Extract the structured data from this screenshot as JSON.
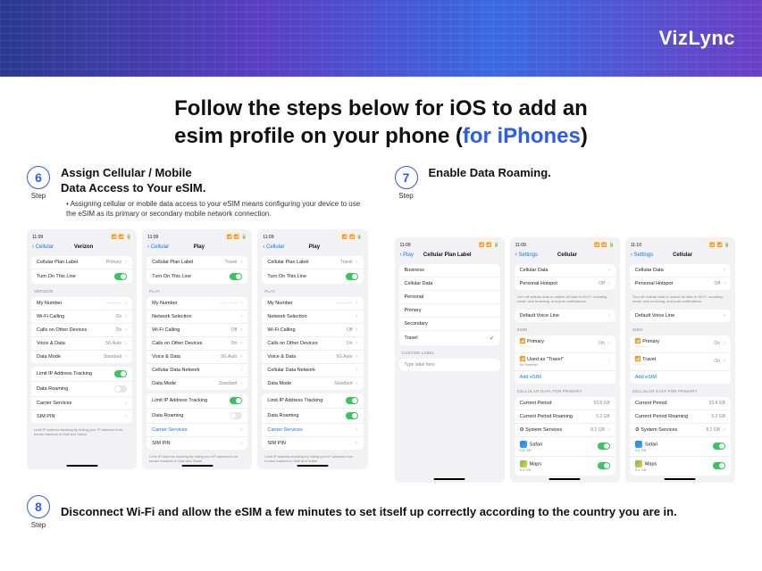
{
  "brand": "VizLync",
  "title_line1": "Follow the steps below for iOS to add an",
  "title_line2_a": "esim profile on your phone (",
  "title_line2_b": "for iPhones",
  "title_line2_c": ")",
  "step_label": "Step",
  "step6": {
    "num": "6",
    "title_a": "Assign Cellular / Mobile",
    "title_b": "Data Access to Your eSIM.",
    "desc": "Assigning cellular or mobile data access to your eSIM means configuring your device to use the eSIM as its primary or secondary mobile network connection.",
    "shot1": {
      "time": "11:09",
      "back": "Cellular",
      "title": "Verizon",
      "plan_label": "Cellular Plan Label",
      "plan_val": "Primary",
      "turnon": "Turn On This Line",
      "gh": "VERIZON",
      "mynum": "My Number",
      "mynum_v": "···········",
      "wifi": "Wi-Fi Calling",
      "wifi_v": "On",
      "calls": "Calls on Other Devices",
      "calls_v": "On",
      "vd": "Voice & Data",
      "vd_v": "5G Auto",
      "dm": "Data Mode",
      "dm_v": "Standard",
      "limit": "Limit IP Address Tracking",
      "roam": "Data Roaming",
      "carrier": "Carrier Services",
      "sim": "SIM PIN",
      "hint": "Limit IP address tracking by hiding your IP address from known trackers in Mail and Safari."
    },
    "shot2": {
      "time": "11:09",
      "back": "Cellular",
      "title": "Play",
      "plan_label": "Cellular Plan Label",
      "plan_val": "Travel",
      "turnon": "Turn On This Line",
      "gh": "PLAY",
      "mynum": "My Number",
      "mynum_v": "···········",
      "ns": "Network Selection",
      "wifi": "Wi-Fi Calling",
      "wifi_v": "Off",
      "calls": "Calls on Other Devices",
      "calls_v": "On",
      "vd": "Voice & Data",
      "vd_v": "5G Auto",
      "cdn": "Cellular Data Network",
      "dm": "Data Mode",
      "dm_v": "Standard",
      "limit": "Limit IP Address Tracking",
      "roam": "Data Roaming",
      "carrier": "Carrier Services",
      "sim": "SIM PIN",
      "hint": "Limit IP address tracking by hiding your IP address from known trackers in Mail and Safari."
    },
    "shot3": {
      "time": "11:09",
      "back": "Cellular",
      "title": "Play",
      "plan_label": "Cellular Plan Label",
      "plan_val": "Travel",
      "turnon": "Turn On This Line",
      "gh": "PLAY",
      "mynum": "My Number",
      "mynum_v": "···········",
      "ns": "Network Selection",
      "wifi": "Wi-Fi Calling",
      "wifi_v": "Off",
      "calls": "Calls on Other Devices",
      "calls_v": "On",
      "vd": "Voice & Data",
      "vd_v": "5G Auto",
      "cdn": "Cellular Data Network",
      "dm": "Data Mode",
      "dm_v": "Standard",
      "limit": "Limit IP Address Tracking",
      "roam": "Data Roaming",
      "carrier": "Carrier Services",
      "sim": "SIM PIN",
      "hint": "Limit IP address tracking by hiding your IP address from known trackers in Mail and Safari."
    }
  },
  "step7": {
    "num": "7",
    "title": "Enable Data Roaming.",
    "shot1": {
      "time": "11:09",
      "back": "Play",
      "title": "Cellular Plan Label",
      "biz": "Business",
      "cell": "Cellular Data",
      "pers": "Personal",
      "prim": "Primary",
      "sec": "Secondary",
      "trav": "Travel",
      "gh": "CUSTOM LABEL",
      "ph": "Type label here"
    },
    "shot2": {
      "time": "11:09",
      "back": "Settings",
      "title": "Cellular",
      "cd": "Cellular Data",
      "hot": "Personal Hotspot",
      "hot_v": "Off",
      "hint": "Turn off cellular data to restrict all data to Wi-Fi, including email, web browsing, and push notifications.",
      "dvl": "Default Voice Line",
      "gh1": "SIMs",
      "p1": "Primary",
      "p1_v": "On",
      "p1s": "···········",
      "p2": "Used as \"Travel\"",
      "p2s": "No Number",
      "add": "Add eSIM",
      "gh2": "CELLULAR DATA FOR PRIMARY",
      "cp": "Current Period",
      "cp_v": "53.8 GB",
      "cpr": "Current Period Roaming",
      "cpr_v": "5.2 GB",
      "ss": "System Services",
      "ss_v": "8.2 GB",
      "saf": "Safari",
      "saf_v": "5.6 GB",
      "map": "Maps",
      "map_v": "5.4 GB"
    },
    "shot3": {
      "time": "11:10",
      "back": "Settings",
      "title": "Cellular",
      "cd": "Cellular Data",
      "hot": "Personal Hotspot",
      "hot_v": "Off",
      "hint": "Turn off cellular data to restrict all data to Wi-Fi, including email, web browsing, and push notifications.",
      "dvl": "Default Voice Line",
      "gh1": "SIMs",
      "p1": "Primary",
      "p1_v": "On",
      "p1s": "···········",
      "p2": "Travel",
      "p2_v": "On",
      "p2s": "···········",
      "add": "Add eSIM",
      "gh2": "CELLULAR DATA FOR PRIMARY",
      "cp": "Current Period",
      "cp_v": "53.8 GB",
      "cpr": "Current Period Roaming",
      "cpr_v": "5.2 GB",
      "ss": "System Services",
      "ss_v": "8.2 GB",
      "saf": "Safari",
      "saf_v": "5.6 GB",
      "map": "Maps",
      "map_v": "5.4 GB"
    }
  },
  "step8": {
    "num": "8",
    "title": "Disconnect Wi-Fi and allow the eSIM a few minutes to set itself up correctly according to the country you are in."
  }
}
